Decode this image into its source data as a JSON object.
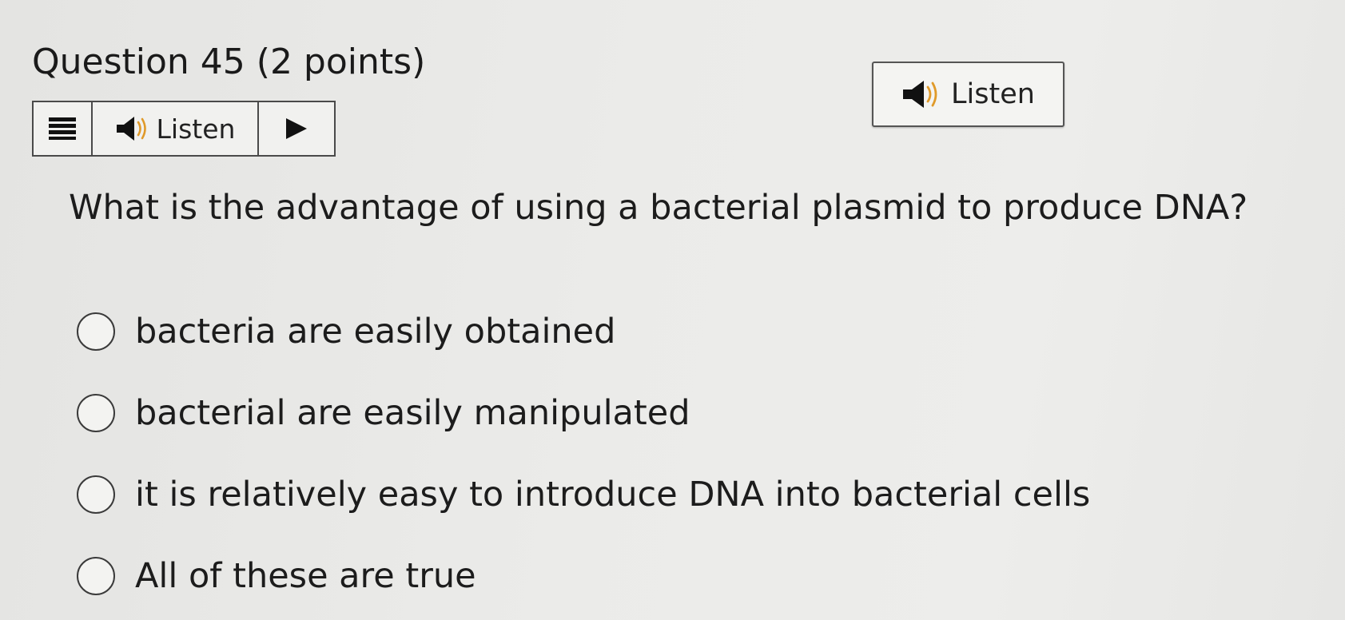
{
  "question": {
    "title": "Question 45",
    "points": "(2 points)",
    "text": "What is the advantage of using a bacterial plasmid to produce DNA?"
  },
  "toolbar": {
    "menu_icon": "menu-icon",
    "listen_label": "Listen",
    "speaker_icon": "speaker-icon",
    "play_icon": "play-icon"
  },
  "listen_button": {
    "label": "Listen",
    "icon": "speaker-icon"
  },
  "options": [
    {
      "label": "bacteria are easily obtained",
      "selected": false
    },
    {
      "label": "bacterial are easily manipulated",
      "selected": false
    },
    {
      "label": "it is relatively easy to introduce DNA into bacterial cells",
      "selected": false
    },
    {
      "label": "All of these are true",
      "selected": false
    }
  ]
}
